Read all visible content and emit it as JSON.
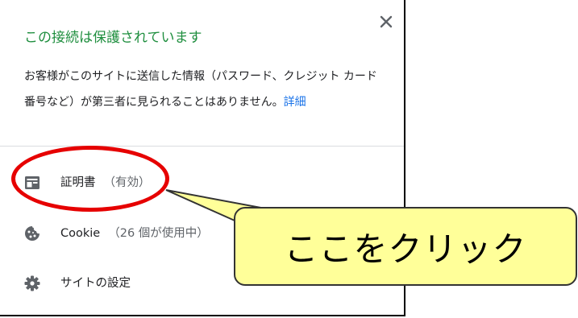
{
  "popup": {
    "close_icon": "close-icon",
    "title": "この接続は保護されています",
    "description": "お客様がこのサイトに送信した情報（パスワード、クレジット カード番号など）が第三者に見られることはありません。",
    "details_link": "詳細",
    "items": [
      {
        "icon": "certificate-icon",
        "label": "証明書",
        "sublabel": "（有効）"
      },
      {
        "icon": "cookie-icon",
        "label": "Cookie",
        "sublabel": "（26 個が使用中）"
      },
      {
        "icon": "gear-icon",
        "label": "サイトの設定",
        "sublabel": ""
      }
    ]
  },
  "annotation": {
    "callout_text": "ここをクリック",
    "highlight_color": "#e60000",
    "callout_bg": "#ffff99"
  },
  "colors": {
    "title_green": "#1e8e3e",
    "link_blue": "#1a73e8",
    "text": "#202124"
  }
}
